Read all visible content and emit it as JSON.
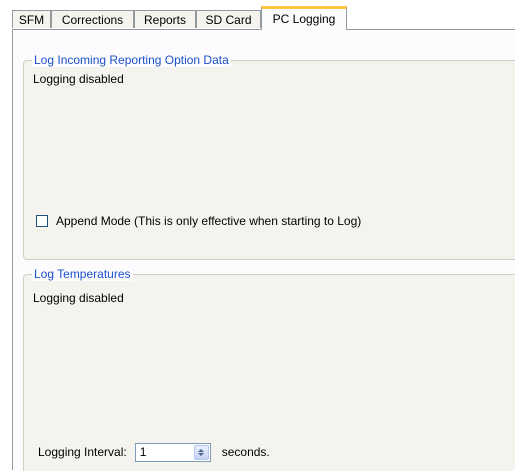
{
  "tabs": [
    {
      "label": "SFM",
      "active": false
    },
    {
      "label": "Corrections",
      "active": false
    },
    {
      "label": "Reports",
      "active": false
    },
    {
      "label": "SD Card",
      "active": false
    },
    {
      "label": "PC Logging",
      "active": true
    }
  ],
  "reporting_group": {
    "title": "Log Incoming Reporting Option Data",
    "status": "Logging disabled",
    "append_checkbox": {
      "label": "Append Mode (This is only effective when starting to Log)",
      "checked": false
    }
  },
  "temperature_group": {
    "title": "Log Temperatures",
    "status": "Logging disabled",
    "interval": {
      "label": "Logging Interval:",
      "value": "1",
      "units": "seconds."
    }
  },
  "colors": {
    "group_title": "#1c50c8",
    "active_tab_accent": "#ffc83c",
    "panel_background": "#f4f3ee"
  }
}
